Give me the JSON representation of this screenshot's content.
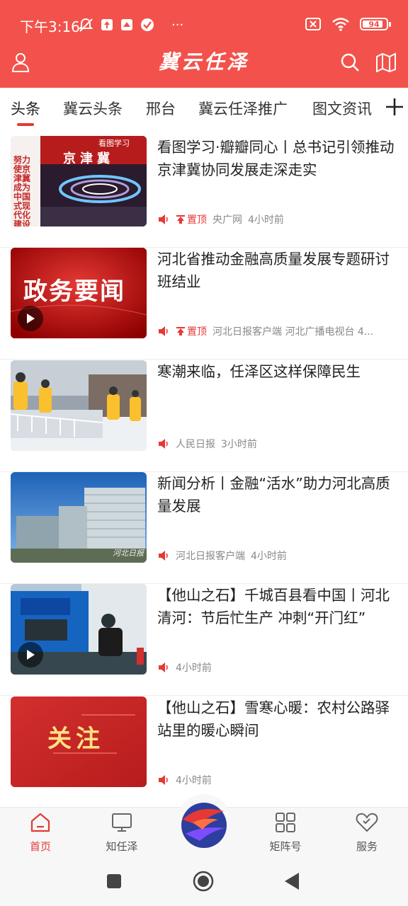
{
  "status_bar": {
    "time": "下午3:16",
    "dots": "···",
    "battery": "94"
  },
  "header": {
    "brand": "冀云任泽"
  },
  "tabs": [
    {
      "label": "头条"
    },
    {
      "label": "冀云头条"
    },
    {
      "label": "邢台"
    },
    {
      "label": "冀云任泽推广"
    },
    {
      "label": "图文资讯"
    }
  ],
  "news": [
    {
      "title": "看图学习·瓣瓣同心丨总书记引领推动京津冀协同发展走深走实",
      "pinned_label": "置顶",
      "source": "央广网",
      "time": "4小时前",
      "thumb_text_left": "努力使京津冀成为中国式现代化建设",
      "thumb_text_top": "京津冀",
      "thumb_badge": "看图学习"
    },
    {
      "title": "河北省推动金融高质量发展专题研讨班结业",
      "pinned_label": "置顶",
      "source": "河北日报客户端 河北广播电视台 4...",
      "time": "",
      "thumb_text": "政务要闻"
    },
    {
      "title": "寒潮来临，任泽区这样保障民生",
      "source": "人民日报",
      "time": "3小时前"
    },
    {
      "title": "新闻分析丨金融“活水”助力河北高质量发展",
      "source": "河北日报客户端",
      "time": "4小时前",
      "thumb_watermark": "河北日报"
    },
    {
      "title": "【他山之石】千城百县看中国丨河北清河：节后忙生产 冲刺“开门红”",
      "source": "",
      "time": "4小时前"
    },
    {
      "title": "【他山之石】雪寒心暖：农村公路驿站里的暖心瞬间",
      "source": "",
      "time": "4小时前",
      "thumb_text": "关注"
    }
  ],
  "bottom_nav": [
    {
      "label": "首页"
    },
    {
      "label": "知任泽"
    },
    {
      "label": "矩阵号"
    },
    {
      "label": "服务"
    }
  ],
  "colors": {
    "brand_red": "#f2524b",
    "accent_red": "#e53935"
  }
}
